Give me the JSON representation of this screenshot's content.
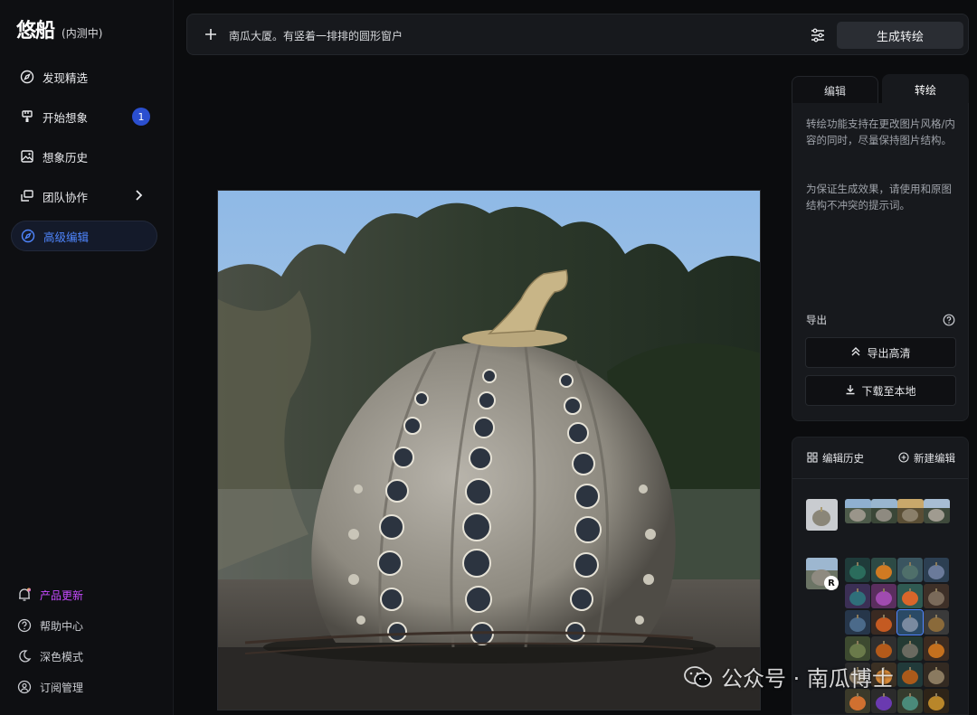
{
  "app": {
    "logo": "悠船",
    "logo_sub": "(内测中)"
  },
  "sidebar": {
    "items": [
      {
        "label": "发现精选",
        "icon": "compass-icon"
      },
      {
        "label": "开始想象",
        "icon": "brush-icon",
        "badge": "1"
      },
      {
        "label": "想象历史",
        "icon": "image-icon"
      },
      {
        "label": "团队协作",
        "icon": "team-icon"
      },
      {
        "label": "高级编辑",
        "icon": "compass-icon",
        "active": true
      }
    ],
    "bottom": [
      {
        "label": "产品更新",
        "icon": "bell-icon"
      },
      {
        "label": "帮助中心",
        "icon": "help-icon"
      },
      {
        "label": "深色模式",
        "icon": "moon-icon"
      },
      {
        "label": "订阅管理",
        "icon": "user-icon"
      }
    ]
  },
  "prompt": {
    "text": "南瓜大厦。有竖着一排排的圆形窗户",
    "generate_label": "生成转绘"
  },
  "panel": {
    "tabs": {
      "edit": "编辑",
      "redraw": "转绘"
    },
    "desc1": "转绘功能支持在更改图片风格/内容的同时，尽量保持图片结构。",
    "desc2": "为保证生成效果，请使用和原图结构不冲突的提示词。",
    "export_label": "导出",
    "export_hd": "导出高清",
    "download": "下载至本地"
  },
  "history": {
    "title": "编辑历史",
    "new_edit": "新建编辑",
    "r_badge": "R"
  },
  "watermark": {
    "text": "公众号 · 南瓜博士"
  },
  "colors": {
    "accent": "#4f86ff",
    "badge": "#2b4fcf",
    "highlight": "#c64bff"
  }
}
